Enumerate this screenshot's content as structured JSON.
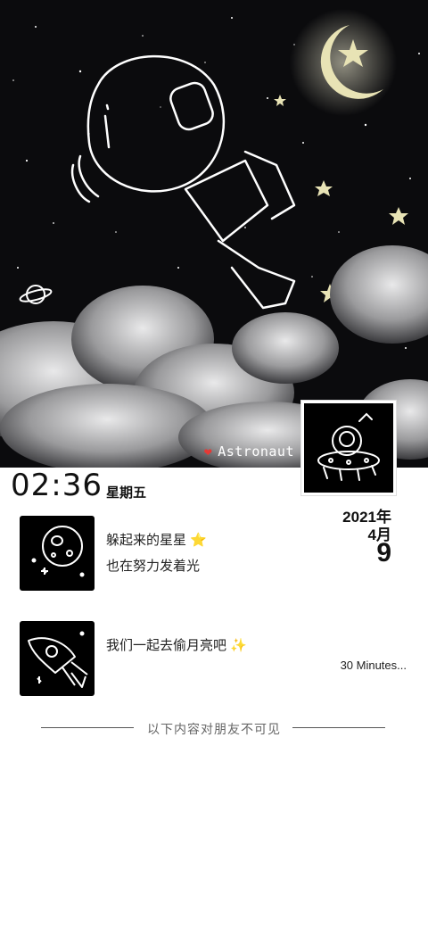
{
  "cover": {
    "caption_heart": "❤",
    "caption_text": "Astronaut"
  },
  "header": {
    "time": "02:36",
    "weekday": "星期五",
    "year_label": "2021年",
    "month_label": "4月",
    "day_label": "9"
  },
  "posts": [
    {
      "line1": "躲起来的星星",
      "line1_emoji": "⭐",
      "line2": "也在努力发着光",
      "thumb_icon": "moon-doodle-icon"
    },
    {
      "line1": "我们一起去偷月亮吧",
      "line1_emoji": "✨",
      "meta": "30 Minutes...",
      "thumb_icon": "rocket-doodle-icon"
    }
  ],
  "footer": {
    "divider_text": "以下内容对朋友不可见"
  },
  "colors": {
    "cover_bg": "#0b0b0d",
    "text": "#111111",
    "heart": "#e53935",
    "star": "#e8e3b5"
  }
}
